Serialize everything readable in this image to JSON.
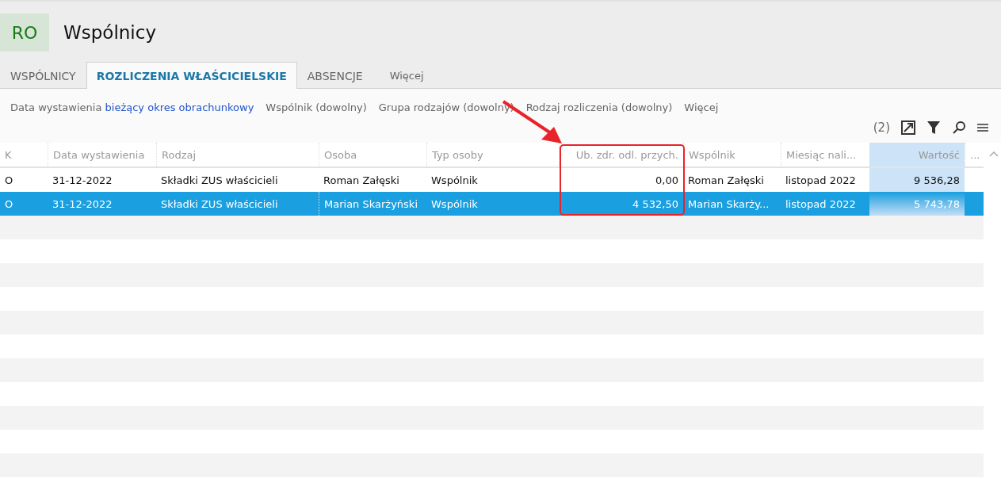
{
  "header": {
    "badge": "RO",
    "title": "Wspólnicy"
  },
  "tabs": [
    {
      "label": "WSPÓLNICY",
      "selected": false
    },
    {
      "label": "ROZLICZENIA WŁAŚCICIELSKIE",
      "selected": true
    },
    {
      "label": "ABSENCJE",
      "selected": false
    },
    {
      "label": "Więcej",
      "selected": false,
      "kind": "more"
    }
  ],
  "filters": [
    {
      "label": "Data wystawienia",
      "value": "bieżący okres obrachunkowy"
    },
    {
      "label": "Wspólnik (dowolny)"
    },
    {
      "label": "Grupa rodzajów (dowolny)"
    },
    {
      "label": "Rodzaj rozliczenia (dowolny)"
    },
    {
      "label": "Więcej"
    }
  ],
  "toolbar": {
    "count": "(2)"
  },
  "table": {
    "columns": [
      {
        "label": "K",
        "sorted": false
      },
      {
        "label": "Data wystawienia",
        "sorted": false
      },
      {
        "label": "Rodzaj",
        "sorted": false
      },
      {
        "label": "Osoba",
        "sorted": false
      },
      {
        "label": "Typ osoby",
        "sorted": false
      },
      {
        "label": "Ub. zdr. odl. przych.",
        "sorted": false
      },
      {
        "label": "Wspólnik",
        "sorted": false
      },
      {
        "label": "Miesiąc nali...",
        "sorted": false
      },
      {
        "label": "Wartość",
        "sorted": true
      },
      {
        "label": "...",
        "sorted": false
      }
    ],
    "rows": [
      {
        "selected": false,
        "cells": [
          "O",
          "31-12-2022",
          "Składki ZUS właścicieli",
          "Roman Załęski",
          "Wspólnik",
          "0,00",
          "Roman Załęski",
          "listopad 2022",
          "9 536,28"
        ]
      },
      {
        "selected": true,
        "cells": [
          "O",
          "31-12-2022",
          "Składki ZUS właścicieli",
          "Marian Skarżyński",
          "Wspólnik",
          "4 532,50",
          "Marian Skarży...",
          "listopad 2022",
          "5 743,78"
        ]
      }
    ]
  }
}
